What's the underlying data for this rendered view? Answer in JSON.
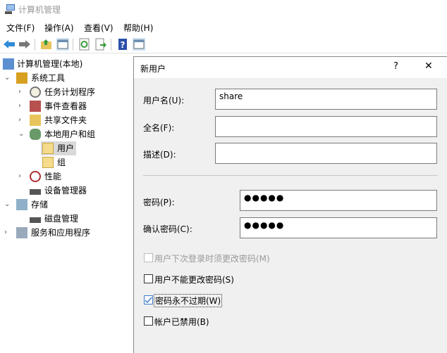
{
  "window": {
    "title": "计算机管理"
  },
  "menu": [
    {
      "label": "文件(F)"
    },
    {
      "label": "操作(A)"
    },
    {
      "label": "查看(V)"
    },
    {
      "label": "帮助(H)"
    }
  ],
  "toolbar": [
    "back-icon",
    "forward-icon",
    "up-folder-icon",
    "show-hide-tree-icon",
    "refresh-icon",
    "export-list-icon",
    "help-icon",
    "show-hide-action-pane-icon"
  ],
  "tree": {
    "root": "计算机管理(本地)",
    "system_tools": "系统工具",
    "task_scheduler": "任务计划程序",
    "event_viewer": "事件查看器",
    "shared_folders": "共享文件夹",
    "local_users": "本地用户和组",
    "users": "用户",
    "groups": "组",
    "performance": "性能",
    "device_manager": "设备管理器",
    "storage": "存储",
    "disk_management": "磁盘管理",
    "services": "服务和应用程序"
  },
  "dialog": {
    "title": "新用户",
    "help": "?",
    "close": "✕",
    "username_label": "用户名(U):",
    "username_key": "U",
    "username_value": "share",
    "fullname_label": "全名(F):",
    "fullname_value": "",
    "description_label": "描述(D):",
    "description_value": "",
    "password_label": "密码(P):",
    "password_value": "●●●●●",
    "confirm_label": "确认密码(C):",
    "confirm_value": "●●●●●",
    "checkboxes": [
      {
        "label": "用户下次登录时须更改密码(M)",
        "checked": false,
        "disabled": true
      },
      {
        "label": "用户不能更改密码(S)",
        "checked": false,
        "disabled": false
      },
      {
        "label": "密码永不过期(W)",
        "checked": true,
        "disabled": false
      },
      {
        "label": "帐户已禁用(B)",
        "checked": false,
        "disabled": false
      }
    ]
  }
}
